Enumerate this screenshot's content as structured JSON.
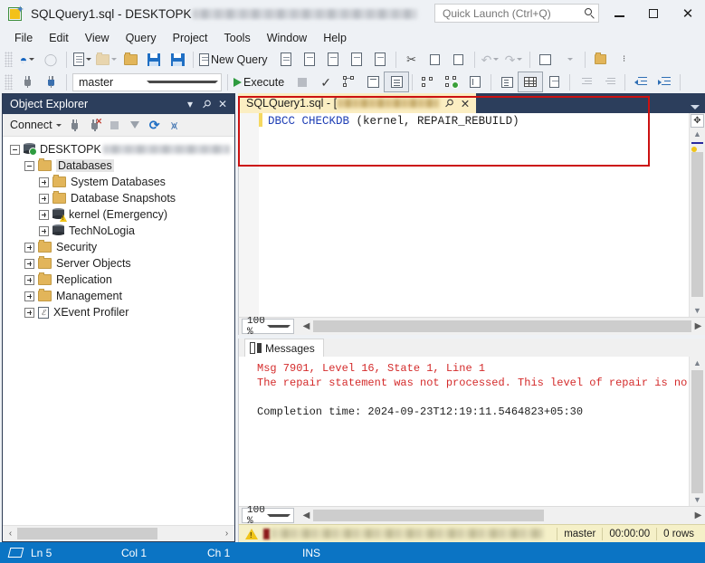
{
  "window": {
    "title_prefix": "SQLQuery1.sql - DESKTOPK",
    "title_redacted": true,
    "app_icon": "sql-file-icon",
    "minimize_label": "Minimize",
    "maximize_label": "Maximize",
    "close_label": "Close"
  },
  "quick_launch": {
    "placeholder": "Quick Launch (Ctrl+Q)",
    "value": "",
    "icon": "search-icon"
  },
  "menu": {
    "items": [
      {
        "label": "File"
      },
      {
        "label": "Edit"
      },
      {
        "label": "View"
      },
      {
        "label": "Query"
      },
      {
        "label": "Project"
      },
      {
        "label": "Tools"
      },
      {
        "label": "Window"
      },
      {
        "label": "Help"
      }
    ]
  },
  "toolbar_main": {
    "connect_label": "",
    "new_query_label": "New Query",
    "buttons": [
      {
        "name": "connect-object-explorer",
        "icon": "power-icon"
      },
      {
        "name": "new-file",
        "icon": "new-document-icon"
      },
      {
        "name": "open-file",
        "icon": "open-folder-icon"
      },
      {
        "name": "open-project",
        "icon": "open-project-icon"
      },
      {
        "name": "save",
        "icon": "save-icon"
      },
      {
        "name": "save-all",
        "icon": "save-all-icon"
      },
      {
        "name": "new-query",
        "icon": "new-query-icon"
      },
      {
        "name": "new-analysis-query",
        "icon": "mdx-query-icon"
      },
      {
        "name": "new-mdx-query",
        "icon": "mdx-icon"
      },
      {
        "name": "new-dmx-query",
        "icon": "dmx-icon"
      },
      {
        "name": "new-xmla-query",
        "icon": "xmla-icon"
      },
      {
        "name": "new-dax-query",
        "icon": "dax-icon"
      },
      {
        "name": "cut",
        "icon": "scissors-icon"
      },
      {
        "name": "copy",
        "icon": "copy-icon"
      },
      {
        "name": "paste",
        "icon": "paste-icon"
      },
      {
        "name": "undo",
        "icon": "undo-icon"
      },
      {
        "name": "redo",
        "icon": "redo-icon"
      },
      {
        "name": "find",
        "icon": "find-icon"
      },
      {
        "name": "navigate-backward",
        "icon": "zoom-find-icon"
      }
    ]
  },
  "toolbar_query": {
    "database_value": "master",
    "execute_label": "Execute",
    "buttons": [
      {
        "name": "debug",
        "icon": "debug-icon"
      },
      {
        "name": "stop",
        "icon": "stop-icon"
      },
      {
        "name": "parse",
        "icon": "check-icon"
      },
      {
        "name": "display-estimated-plan",
        "icon": "estimated-plan-icon"
      },
      {
        "name": "query-options",
        "icon": "query-options-icon"
      },
      {
        "name": "intellisense",
        "icon": "intellisense-icon"
      },
      {
        "name": "include-actual-plan",
        "icon": "actual-plan-icon"
      },
      {
        "name": "include-client-statistics",
        "icon": "client-stats-icon"
      },
      {
        "name": "include-live-stats",
        "icon": "live-stats-icon"
      },
      {
        "name": "results-to-text",
        "icon": "results-text-icon"
      },
      {
        "name": "results-to-grid",
        "icon": "results-grid-icon"
      },
      {
        "name": "results-to-file",
        "icon": "results-file-icon"
      },
      {
        "name": "comment-lines",
        "icon": "comment-icon"
      },
      {
        "name": "uncomment-lines",
        "icon": "uncomment-icon"
      },
      {
        "name": "decrease-indent",
        "icon": "decrease-indent-icon"
      },
      {
        "name": "increase-indent",
        "icon": "increase-indent-icon"
      }
    ]
  },
  "object_explorer": {
    "title": "Object Explorer",
    "connect_label": "Connect",
    "toolbar_buttons": [
      {
        "name": "connect",
        "icon": "plug-icon"
      },
      {
        "name": "disconnect",
        "icon": "plug-disconnect-icon"
      },
      {
        "name": "stop",
        "icon": "stop-icon"
      },
      {
        "name": "filter",
        "icon": "filter-icon"
      },
      {
        "name": "refresh",
        "icon": "refresh-icon"
      },
      {
        "name": "activity-monitor",
        "icon": "activity-monitor-icon"
      }
    ],
    "tree": [
      {
        "label": "DESKTOPK",
        "redacted": true,
        "icon": "server-icon",
        "indent": 0,
        "expander": "minus",
        "selected": false
      },
      {
        "label": "Databases",
        "icon": "folder-icon",
        "indent": 1,
        "expander": "minus",
        "selected": true
      },
      {
        "label": "System Databases",
        "icon": "folder-icon",
        "indent": 2,
        "expander": "plus",
        "selected": false
      },
      {
        "label": "Database Snapshots",
        "icon": "folder-icon",
        "indent": 2,
        "expander": "plus",
        "selected": false
      },
      {
        "label": "kernel (Emergency)",
        "icon": "database-warning-icon",
        "indent": 2,
        "expander": "plus",
        "selected": false
      },
      {
        "label": "TechNoLogia",
        "icon": "database-icon",
        "indent": 2,
        "expander": "plus",
        "selected": false
      },
      {
        "label": "Security",
        "icon": "folder-icon",
        "indent": 1,
        "expander": "plus",
        "selected": false
      },
      {
        "label": "Server Objects",
        "icon": "folder-icon",
        "indent": 1,
        "expander": "plus",
        "selected": false
      },
      {
        "label": "Replication",
        "icon": "folder-icon",
        "indent": 1,
        "expander": "plus",
        "selected": false
      },
      {
        "label": "Management",
        "icon": "folder-icon",
        "indent": 1,
        "expander": "plus",
        "selected": false
      },
      {
        "label": "XEvent Profiler",
        "icon": "xevent-icon",
        "indent": 1,
        "expander": "plus",
        "selected": false
      }
    ]
  },
  "editor": {
    "tab_title": "SQLQuery1.sql - [",
    "tab_redacted": true,
    "pin_label": "Pin tab",
    "close_label": "Close tab",
    "code_keyword_1": "DBCC",
    "code_keyword_2": "CHECKDB",
    "code_rest": " (kernel, REPAIR_REBUILD)",
    "zoom": "100 %"
  },
  "messages": {
    "tab_label": "Messages",
    "error_line_1": "Msg 7901, Level 16, State 1, Line 1",
    "error_line_2": "The repair statement was not processed. This level of repair is no",
    "completion_line": "Completion time: 2024-09-23T12:19:11.5464823+05:30",
    "zoom": "100 %"
  },
  "query_status": {
    "warning_icon": "warning-icon",
    "server_info_redacted": true,
    "database": "master",
    "elapsed": "00:00:00",
    "rows": "0 rows"
  },
  "status_bar": {
    "line": "Ln 5",
    "column": "Col 1",
    "char": "Ch 1",
    "insert_mode": "INS"
  },
  "annotation": {
    "color": "#cc1111",
    "shape": "rectangle"
  }
}
